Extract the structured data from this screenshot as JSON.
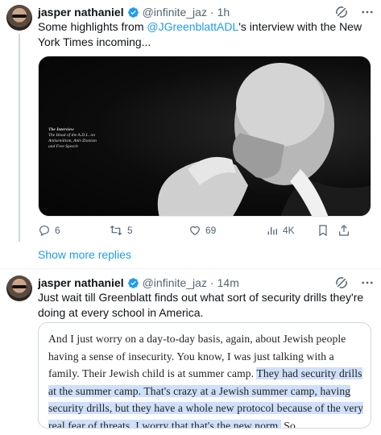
{
  "tweet1": {
    "name": "jasper nathaniel",
    "handle": "@infinite_jaz",
    "time": "1h",
    "text_before": "Some highlights from ",
    "mention": "@JGreenblattADL",
    "text_after": "'s interview with the New York Times incoming...",
    "media_caption_title": "The Interview",
    "media_caption_body": "The Head of the A.D.L. on Antisemitism, Anti-Zionism and Free Speech",
    "actions": {
      "replies": "6",
      "reposts": "5",
      "likes": "69",
      "views": "4K"
    }
  },
  "show_more": "Show more replies",
  "tweet2": {
    "name": "jasper nathaniel",
    "handle": "@infinite_jaz",
    "time": "14m",
    "text": "Just wait till Greenblatt finds out what sort of security drills they're doing at every school in America.",
    "quote_plain": "And I just worry on a day-to-day basis, again, about Jewish people having a sense of insecurity. You know, I was just talking with a family. Their Jewish child is at summer camp. ",
    "quote_highlight": "They had security drills at the summer camp. That's crazy at a Jewish summer camp, having security drills, but they have a whole new protocol because of the very real fear of threats. I worry that that's the new norm.",
    "quote_tail": " So"
  },
  "icons": {
    "verified": "verified-badge-icon",
    "grok": "grok-icon",
    "more": "more-icon",
    "reply": "reply-icon",
    "repost": "repost-icon",
    "like": "like-icon",
    "views": "views-icon",
    "bookmark": "bookmark-icon",
    "share": "share-icon"
  },
  "colors": {
    "accent": "#1d9bf0",
    "text": "#0f1419",
    "muted": "#536471",
    "highlight": "#cfe0fa"
  }
}
